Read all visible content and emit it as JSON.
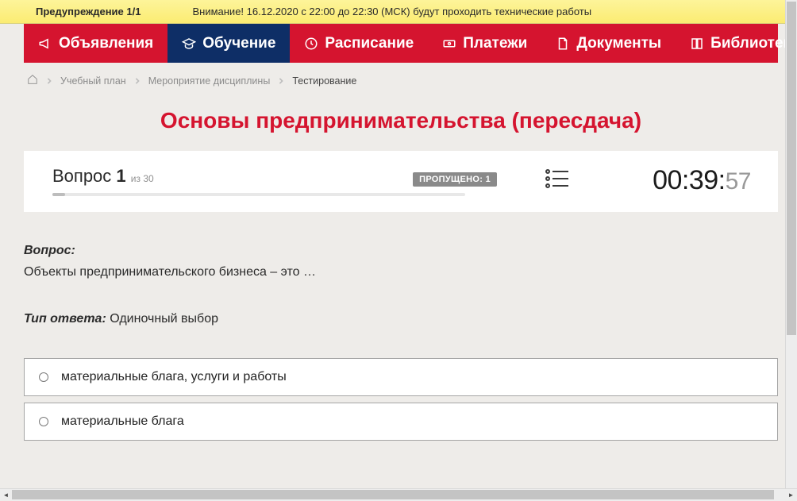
{
  "warning": {
    "title": "Предупреждение 1/1",
    "message": "Внимание! 16.12.2020 с 22:00 до 22:30 (МСК) будут проходить технические работы",
    "close": "x"
  },
  "nav": {
    "items": [
      {
        "label": "Объявления",
        "icon": "megaphone-icon"
      },
      {
        "label": "Обучение",
        "icon": "graduation-icon",
        "active": true
      },
      {
        "label": "Расписание",
        "icon": "clock-icon"
      },
      {
        "label": "Платежи",
        "icon": "cash-icon"
      },
      {
        "label": "Документы",
        "icon": "file-icon"
      },
      {
        "label": "Библиотека",
        "icon": "book-icon",
        "chevron": true
      }
    ]
  },
  "breadcrumbs": {
    "items": [
      {
        "label": "Учебный план"
      },
      {
        "label": "Мероприятие дисциплины"
      }
    ],
    "current": "Тестирование"
  },
  "page_title": "Основы предпринимательства (пересдача)",
  "question_header": {
    "question_word": "Вопрос",
    "number": "1",
    "of_word": "из",
    "total": "30",
    "skipped_label": "ПРОПУЩЕНО: 1",
    "timer_main": "00:39:",
    "timer_sec": "57"
  },
  "question": {
    "heading": "Вопрос:",
    "text": "Объекты предпринимательского бизнеса – это …",
    "answer_type_label": "Тип ответа:",
    "answer_type_value": "Одиночный выбор"
  },
  "answers": [
    {
      "text": "материальные блага, услуги и работы"
    },
    {
      "text": "материальные блага"
    }
  ]
}
